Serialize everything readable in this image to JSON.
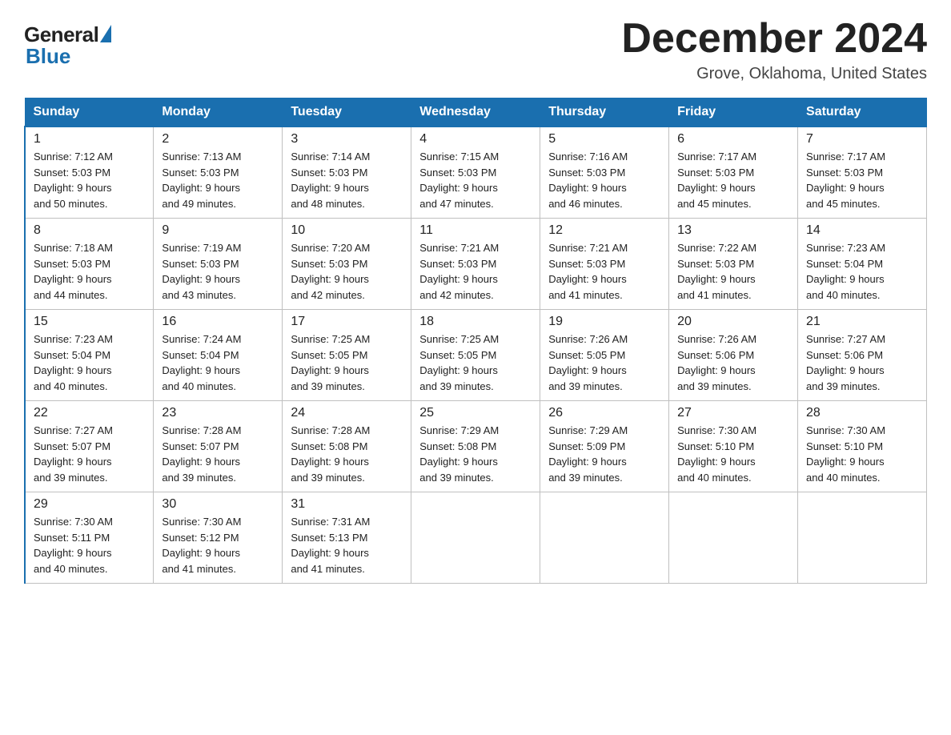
{
  "header": {
    "logo_general": "General",
    "logo_blue": "Blue",
    "month_title": "December 2024",
    "location": "Grove, Oklahoma, United States"
  },
  "days_of_week": [
    "Sunday",
    "Monday",
    "Tuesday",
    "Wednesday",
    "Thursday",
    "Friday",
    "Saturday"
  ],
  "weeks": [
    [
      {
        "day": "1",
        "sunrise": "7:12 AM",
        "sunset": "5:03 PM",
        "daylight_hours": "9",
        "daylight_minutes": "50"
      },
      {
        "day": "2",
        "sunrise": "7:13 AM",
        "sunset": "5:03 PM",
        "daylight_hours": "9",
        "daylight_minutes": "49"
      },
      {
        "day": "3",
        "sunrise": "7:14 AM",
        "sunset": "5:03 PM",
        "daylight_hours": "9",
        "daylight_minutes": "48"
      },
      {
        "day": "4",
        "sunrise": "7:15 AM",
        "sunset": "5:03 PM",
        "daylight_hours": "9",
        "daylight_minutes": "47"
      },
      {
        "day": "5",
        "sunrise": "7:16 AM",
        "sunset": "5:03 PM",
        "daylight_hours": "9",
        "daylight_minutes": "46"
      },
      {
        "day": "6",
        "sunrise": "7:17 AM",
        "sunset": "5:03 PM",
        "daylight_hours": "9",
        "daylight_minutes": "45"
      },
      {
        "day": "7",
        "sunrise": "7:17 AM",
        "sunset": "5:03 PM",
        "daylight_hours": "9",
        "daylight_minutes": "45"
      }
    ],
    [
      {
        "day": "8",
        "sunrise": "7:18 AM",
        "sunset": "5:03 PM",
        "daylight_hours": "9",
        "daylight_minutes": "44"
      },
      {
        "day": "9",
        "sunrise": "7:19 AM",
        "sunset": "5:03 PM",
        "daylight_hours": "9",
        "daylight_minutes": "43"
      },
      {
        "day": "10",
        "sunrise": "7:20 AM",
        "sunset": "5:03 PM",
        "daylight_hours": "9",
        "daylight_minutes": "42"
      },
      {
        "day": "11",
        "sunrise": "7:21 AM",
        "sunset": "5:03 PM",
        "daylight_hours": "9",
        "daylight_minutes": "42"
      },
      {
        "day": "12",
        "sunrise": "7:21 AM",
        "sunset": "5:03 PM",
        "daylight_hours": "9",
        "daylight_minutes": "41"
      },
      {
        "day": "13",
        "sunrise": "7:22 AM",
        "sunset": "5:03 PM",
        "daylight_hours": "9",
        "daylight_minutes": "41"
      },
      {
        "day": "14",
        "sunrise": "7:23 AM",
        "sunset": "5:04 PM",
        "daylight_hours": "9",
        "daylight_minutes": "40"
      }
    ],
    [
      {
        "day": "15",
        "sunrise": "7:23 AM",
        "sunset": "5:04 PM",
        "daylight_hours": "9",
        "daylight_minutes": "40"
      },
      {
        "day": "16",
        "sunrise": "7:24 AM",
        "sunset": "5:04 PM",
        "daylight_hours": "9",
        "daylight_minutes": "40"
      },
      {
        "day": "17",
        "sunrise": "7:25 AM",
        "sunset": "5:05 PM",
        "daylight_hours": "9",
        "daylight_minutes": "39"
      },
      {
        "day": "18",
        "sunrise": "7:25 AM",
        "sunset": "5:05 PM",
        "daylight_hours": "9",
        "daylight_minutes": "39"
      },
      {
        "day": "19",
        "sunrise": "7:26 AM",
        "sunset": "5:05 PM",
        "daylight_hours": "9",
        "daylight_minutes": "39"
      },
      {
        "day": "20",
        "sunrise": "7:26 AM",
        "sunset": "5:06 PM",
        "daylight_hours": "9",
        "daylight_minutes": "39"
      },
      {
        "day": "21",
        "sunrise": "7:27 AM",
        "sunset": "5:06 PM",
        "daylight_hours": "9",
        "daylight_minutes": "39"
      }
    ],
    [
      {
        "day": "22",
        "sunrise": "7:27 AM",
        "sunset": "5:07 PM",
        "daylight_hours": "9",
        "daylight_minutes": "39"
      },
      {
        "day": "23",
        "sunrise": "7:28 AM",
        "sunset": "5:07 PM",
        "daylight_hours": "9",
        "daylight_minutes": "39"
      },
      {
        "day": "24",
        "sunrise": "7:28 AM",
        "sunset": "5:08 PM",
        "daylight_hours": "9",
        "daylight_minutes": "39"
      },
      {
        "day": "25",
        "sunrise": "7:29 AM",
        "sunset": "5:08 PM",
        "daylight_hours": "9",
        "daylight_minutes": "39"
      },
      {
        "day": "26",
        "sunrise": "7:29 AM",
        "sunset": "5:09 PM",
        "daylight_hours": "9",
        "daylight_minutes": "39"
      },
      {
        "day": "27",
        "sunrise": "7:30 AM",
        "sunset": "5:10 PM",
        "daylight_hours": "9",
        "daylight_minutes": "40"
      },
      {
        "day": "28",
        "sunrise": "7:30 AM",
        "sunset": "5:10 PM",
        "daylight_hours": "9",
        "daylight_minutes": "40"
      }
    ],
    [
      {
        "day": "29",
        "sunrise": "7:30 AM",
        "sunset": "5:11 PM",
        "daylight_hours": "9",
        "daylight_minutes": "40"
      },
      {
        "day": "30",
        "sunrise": "7:30 AM",
        "sunset": "5:12 PM",
        "daylight_hours": "9",
        "daylight_minutes": "41"
      },
      {
        "day": "31",
        "sunrise": "7:31 AM",
        "sunset": "5:13 PM",
        "daylight_hours": "9",
        "daylight_minutes": "41"
      },
      null,
      null,
      null,
      null
    ]
  ]
}
